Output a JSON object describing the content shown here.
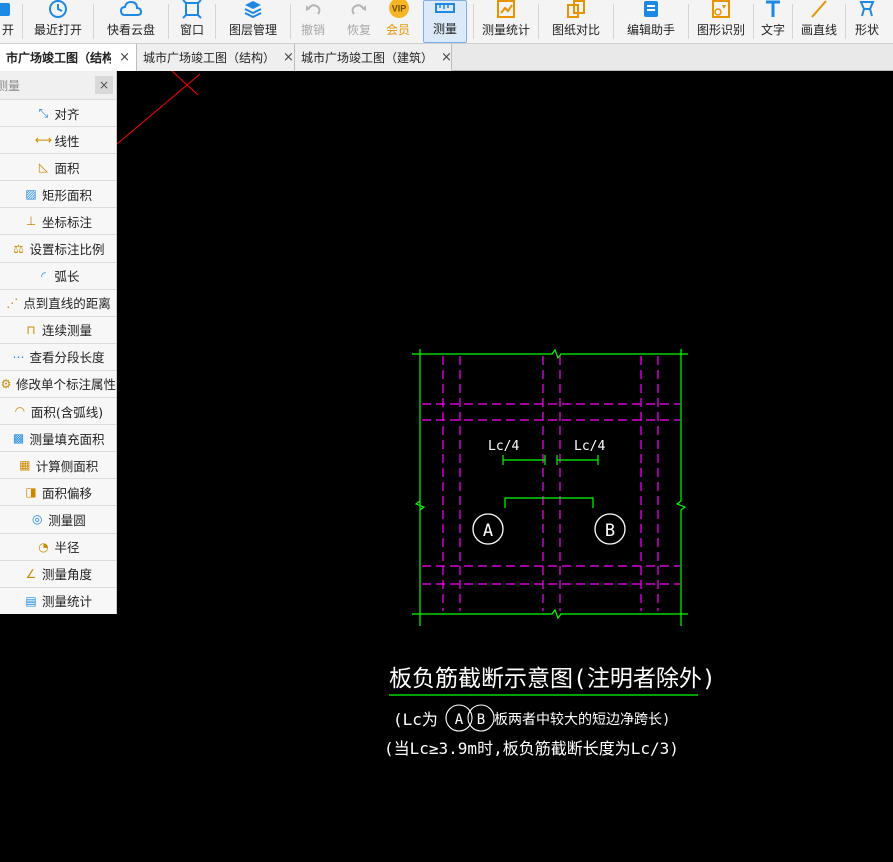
{
  "toolbar": {
    "items": [
      {
        "label": "开",
        "icon": "open-icon"
      },
      {
        "label": "最近打开",
        "icon": "recent-icon"
      },
      {
        "label": "快看云盘",
        "icon": "cloud-icon"
      },
      {
        "label": "窗口",
        "icon": "window-icon"
      },
      {
        "label": "图层管理",
        "icon": "layers-icon"
      },
      {
        "label": "撤销",
        "icon": "undo-icon"
      },
      {
        "label": "恢复",
        "icon": "redo-icon"
      },
      {
        "label": "会员",
        "icon": "vip-icon",
        "badge": "VIP"
      },
      {
        "label": "测量",
        "icon": "measure-icon"
      },
      {
        "label": "测量统计",
        "icon": "measure-stats-icon"
      },
      {
        "label": "图纸对比",
        "icon": "compare-icon"
      },
      {
        "label": "编辑助手",
        "icon": "edit-assistant-icon"
      },
      {
        "label": "图形识别",
        "icon": "shape-recognition-icon"
      },
      {
        "label": "文字",
        "icon": "text-icon"
      },
      {
        "label": "画直线",
        "icon": "line-icon"
      },
      {
        "label": "形状",
        "icon": "shape-icon"
      }
    ]
  },
  "tabs": [
    {
      "label": "市广场竣工图（结构",
      "active": true
    },
    {
      "label": "城市广场竣工图（结构）",
      "active": false
    },
    {
      "label": "城市广场竣工图（建筑）",
      "active": false
    }
  ],
  "measure_panel": {
    "title": "测量",
    "close_label": "×",
    "items": [
      {
        "label": "对齐",
        "icon": "align-icon"
      },
      {
        "label": "线性",
        "icon": "linear-icon"
      },
      {
        "label": "面积",
        "icon": "area-icon"
      },
      {
        "label": "矩形面积",
        "icon": "rect-area-icon"
      },
      {
        "label": "坐标标注",
        "icon": "coordinate-icon"
      },
      {
        "label": "设置标注比例",
        "icon": "scale-icon"
      },
      {
        "label": "弧长",
        "icon": "arc-length-icon"
      },
      {
        "label": "点到直线的距离",
        "icon": "point-line-distance-icon"
      },
      {
        "label": "连续测量",
        "icon": "continuous-measure-icon"
      },
      {
        "label": "查看分段长度",
        "icon": "segment-length-icon"
      },
      {
        "label": "修改单个标注属性",
        "icon": "edit-annotation-icon"
      },
      {
        "label": "面积(含弧线)",
        "icon": "arc-area-icon"
      },
      {
        "label": "测量填充面积",
        "icon": "fill-area-icon"
      },
      {
        "label": "计算侧面积",
        "icon": "side-area-icon"
      },
      {
        "label": "面积偏移",
        "icon": "area-offset-icon"
      },
      {
        "label": "测量圆",
        "icon": "circle-icon"
      },
      {
        "label": "半径",
        "icon": "radius-icon"
      },
      {
        "label": "测量角度",
        "icon": "angle-icon"
      },
      {
        "label": "测量统计",
        "icon": "stats-icon"
      }
    ]
  },
  "drawing": {
    "dim_label_left": "Lc/4",
    "dim_label_right": "Lc/4",
    "circle_a": "A",
    "circle_b": "B",
    "title": "板负筋截断示意图(注明者除外)",
    "note1_prefix": "(Lc为",
    "note1_a": "A",
    "note1_b": "B",
    "note1_suffix": "板两者中较大的短边净跨长)",
    "note2": "(当Lc≥3.9m时,板负筋截断长度为Lc/3)"
  },
  "colors": {
    "canvas": "#000000",
    "grid_green": "#00ff00",
    "rebar_magenta": "#ff00ff",
    "crosshair_red": "#ff0000",
    "accent_blue": "#1e88e5"
  }
}
